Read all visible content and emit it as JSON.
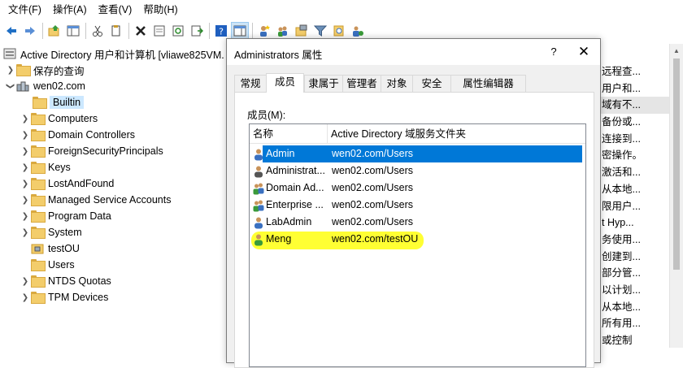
{
  "menu": [
    "文件(F)",
    "操作(A)",
    "查看(V)",
    "帮助(H)"
  ],
  "toolbar_icons": [
    "back-icon",
    "forward-icon",
    "up-folder-icon",
    "console-tree-icon",
    "cut-icon",
    "copy-icon",
    "delete-icon",
    "properties-icon",
    "refresh-icon",
    "export-icon",
    "help-icon",
    "show-hide-icon",
    "new-user-icon",
    "new-group-icon",
    "new-ou-icon",
    "filter-icon",
    "find-icon",
    "add-to-group-icon"
  ],
  "tree": {
    "root": "Active Directory 用户和计算机 [vliawe825VM.",
    "saved_queries": "保存的查询",
    "domain": "wen02.com",
    "items": [
      "Builtin",
      "Computers",
      "Domain Controllers",
      "ForeignSecurityPrincipals",
      "Keys",
      "LostAndFound",
      "Managed Service Accounts",
      "Program Data",
      "System",
      "testOU",
      "Users",
      "NTDS Quotas",
      "TPM Devices"
    ],
    "selected": "Builtin"
  },
  "right_list": [
    "远程查...",
    "用户和...",
    "域有不...",
    "备份或...",
    "连接到...",
    "密操作。",
    "激活和...",
    "从本地...",
    "限用户...",
    "t Hyp...",
    "务使用...",
    "创建到...",
    "部分管...",
    "以计划...",
    "从本地...",
    "所有用...",
    "或控制"
  ],
  "dialog": {
    "title": "Administrators 属性",
    "help": "?",
    "close": "✕",
    "tabs": [
      "常规",
      "成员",
      "隶属于",
      "管理者",
      "对象",
      "安全",
      "属性编辑器"
    ],
    "active_tab": "成员",
    "members_label": "成员(M):",
    "columns": [
      "名称",
      "Active Directory 域服务文件夹"
    ],
    "rows": [
      {
        "name": "Admin",
        "folder": "wen02.com/Users",
        "type": "user"
      },
      {
        "name": "Administrat...",
        "folder": "wen02.com/Users",
        "type": "user"
      },
      {
        "name": "Domain Ad...",
        "folder": "wen02.com/Users",
        "type": "group"
      },
      {
        "name": "Enterprise ...",
        "folder": "wen02.com/Users",
        "type": "group"
      },
      {
        "name": "LabAdmin",
        "folder": "wen02.com/Users",
        "type": "user"
      },
      {
        "name": "Meng",
        "folder": "wen02.com/testOU",
        "type": "user"
      }
    ],
    "selected_row": "Admin",
    "highlighted_row": "Meng"
  },
  "colors": {
    "selection": "#0078d7",
    "highlight": "#ffff33",
    "tree_selection": "#cce8ff"
  }
}
